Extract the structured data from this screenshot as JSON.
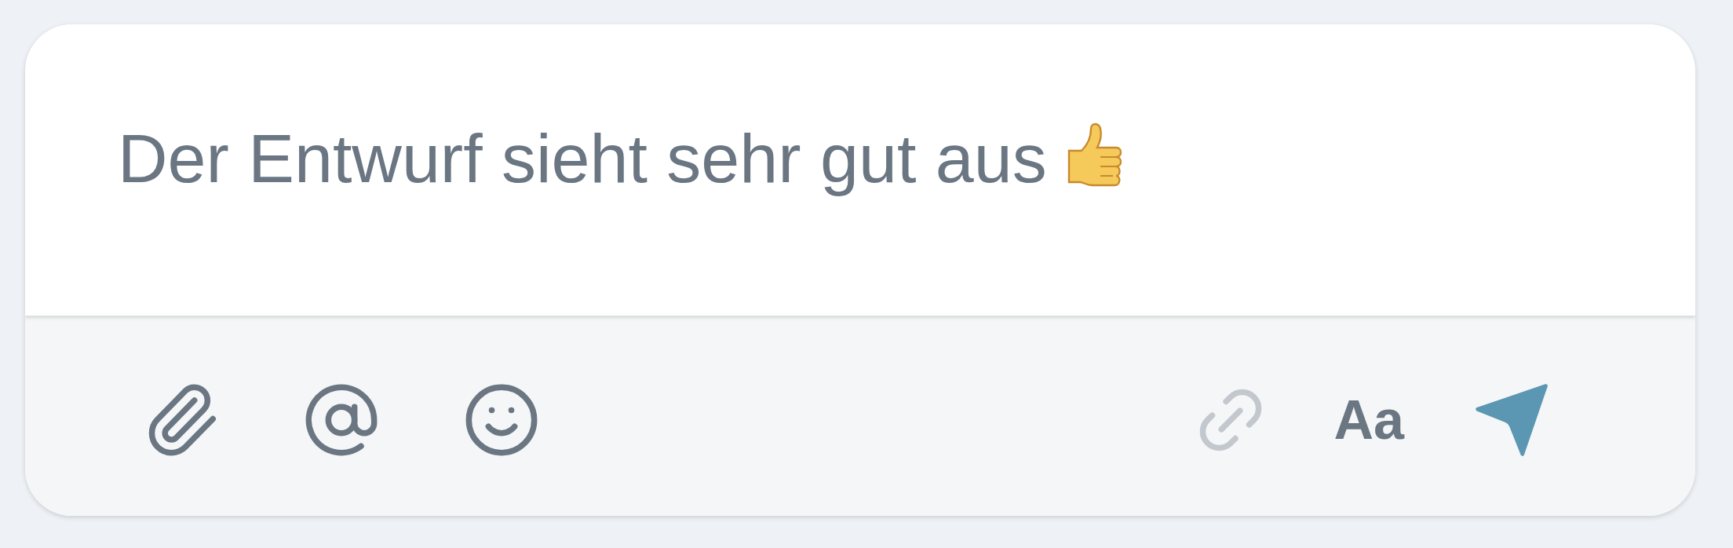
{
  "message": {
    "text": "Der Entwurf sieht sehr gut aus"
  },
  "toolbar": {
    "left": [
      {
        "kind": "attach",
        "disabled": false
      },
      {
        "kind": "mention",
        "disabled": false
      },
      {
        "kind": "emoji",
        "disabled": false
      }
    ],
    "right": [
      {
        "kind": "link",
        "disabled": true
      },
      {
        "kind": "format",
        "label": "Aa",
        "disabled": false
      },
      {
        "kind": "send",
        "disabled": false
      }
    ]
  }
}
